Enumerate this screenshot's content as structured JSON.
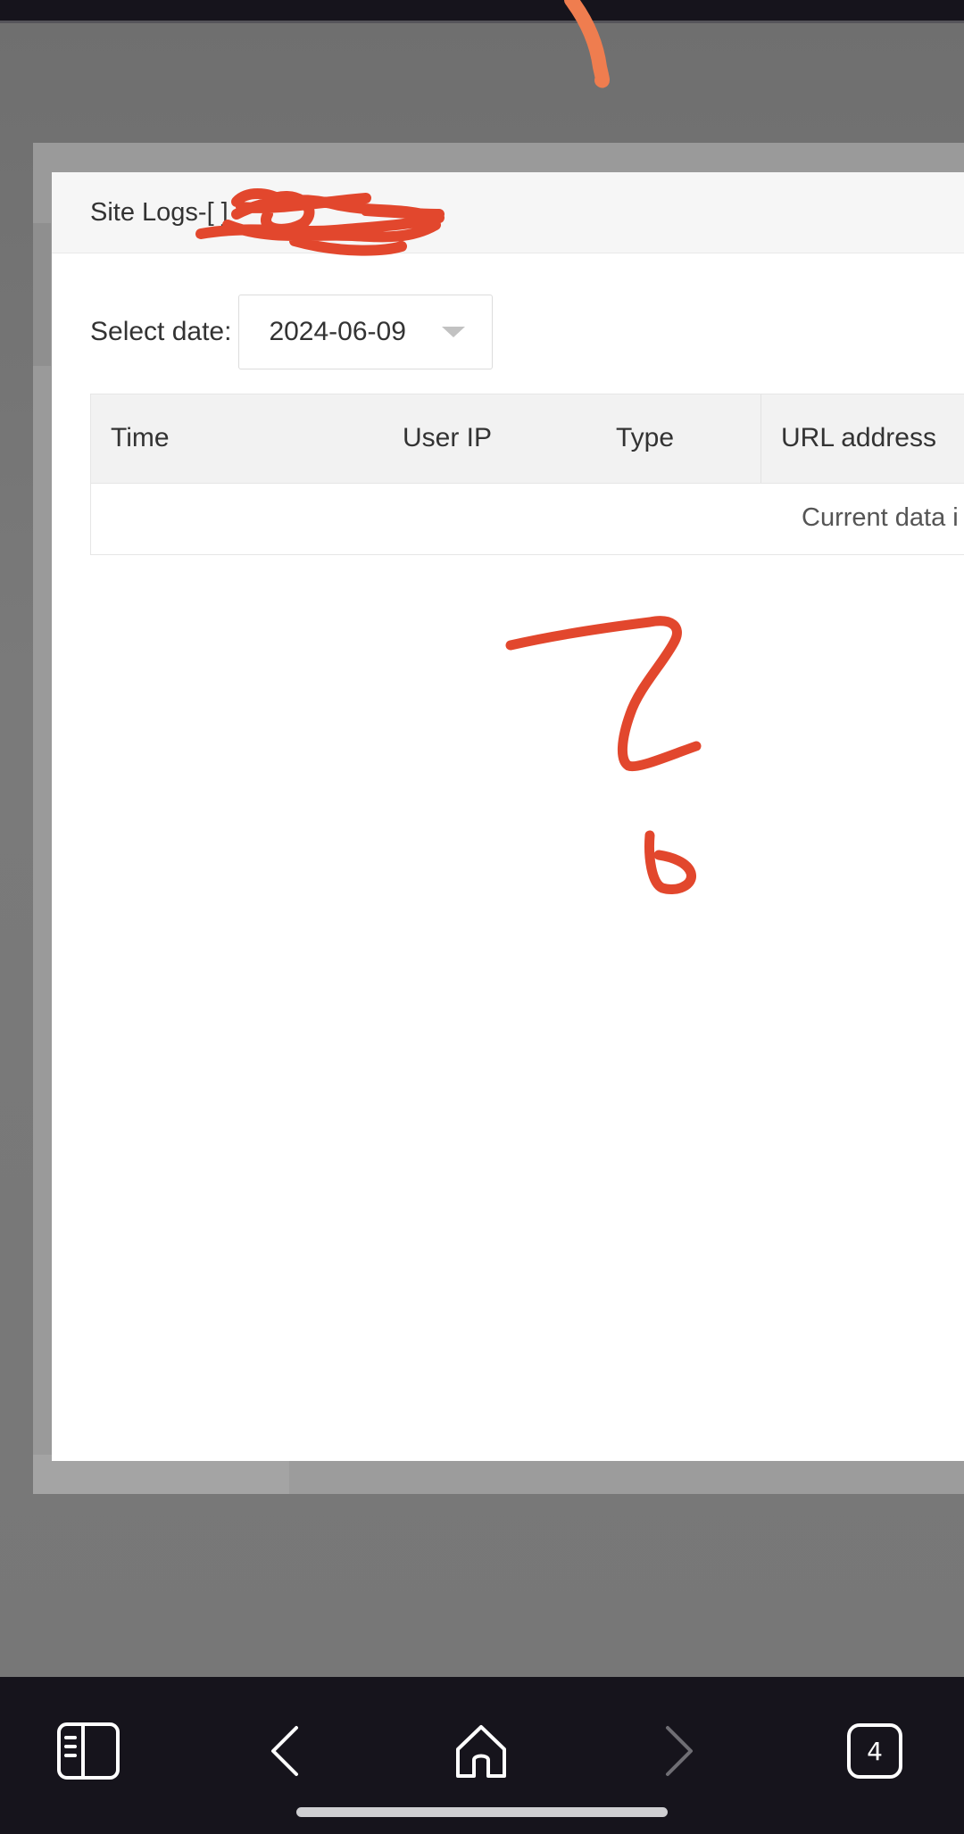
{
  "dialog": {
    "title": "Site Logs-[ ]",
    "date_label": "Select date:",
    "date_value": "2024-06-09",
    "table": {
      "columns": [
        "Time",
        "User IP",
        "Type",
        "URL address"
      ],
      "empty_text": "Current data i"
    }
  },
  "browser_nav": {
    "sidebar_icon": "sidebar-icon",
    "back_icon": "chevron-left-icon",
    "home_icon": "home-icon",
    "forward_icon": "chevron-right-icon",
    "tab_count": "4"
  },
  "annotations": {
    "ink_color": "#e2472d",
    "top_stroke_color": "#ef7d4f"
  }
}
